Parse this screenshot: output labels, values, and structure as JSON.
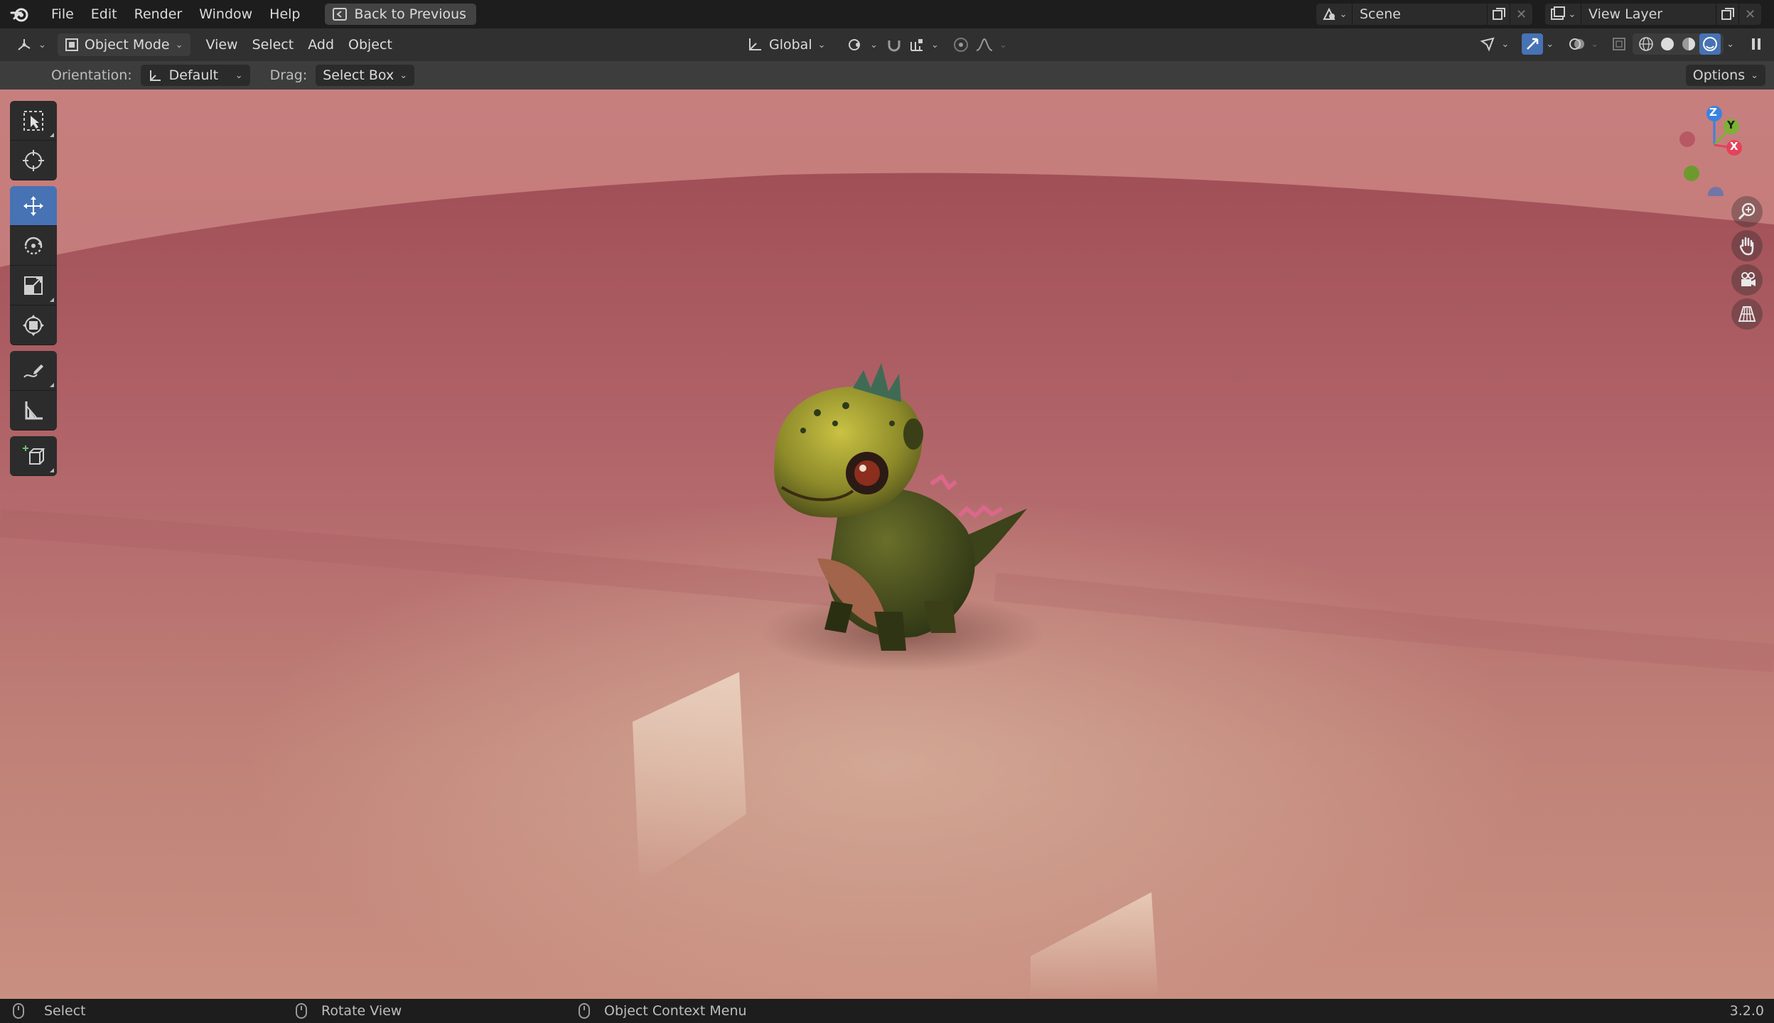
{
  "topbar": {
    "menus": [
      "File",
      "Edit",
      "Render",
      "Window",
      "Help"
    ],
    "back_label": "Back to Previous",
    "scene_name": "Scene",
    "view_layer_name": "View Layer"
  },
  "header": {
    "mode_label": "Object Mode",
    "menus": [
      "View",
      "Select",
      "Add",
      "Object"
    ],
    "transform_orientation": "Global"
  },
  "toolsettings": {
    "orientation_label": "Orientation:",
    "orientation_value": "Default",
    "drag_label": "Drag:",
    "drag_value": "Select Box",
    "options_label": "Options"
  },
  "toolbar": {
    "tools": [
      "select-box",
      "cursor",
      "move",
      "rotate",
      "scale",
      "transform",
      "annotate",
      "measure",
      "add-cube"
    ],
    "active_tool": "move"
  },
  "gizmo": {
    "axes": {
      "z": "Z",
      "y": "Y",
      "x": "X"
    },
    "colors": {
      "x": "#e4425a",
      "y": "#7cb135",
      "z": "#3a82e0"
    }
  },
  "statusbar": {
    "select": "Select",
    "rotate": "Rotate View",
    "context": "Object Context Menu",
    "version": "3.2.0"
  },
  "colors": {
    "accent": "#4772b3",
    "floor": "#b86f6a",
    "sky": "#c77f7e"
  }
}
